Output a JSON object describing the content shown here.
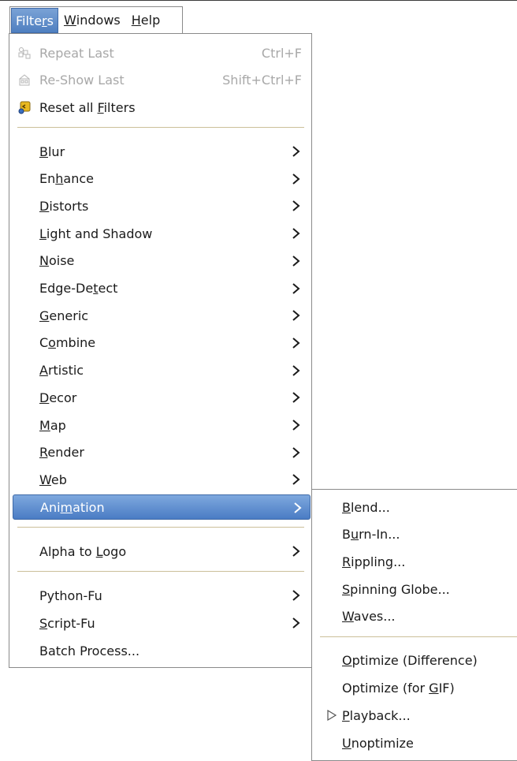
{
  "menubar": {
    "items": [
      {
        "pre": "Filte",
        "mn": "r",
        "post": "s",
        "active": true
      },
      {
        "pre": "",
        "mn": "W",
        "post": "indows"
      },
      {
        "pre": "",
        "mn": "H",
        "post": "elp"
      }
    ]
  },
  "filters_menu": {
    "repeat_last": {
      "label": "Repeat Last",
      "accel": "Ctrl+F",
      "icon": "repeat-icon"
    },
    "reshow_last": {
      "label": "Re-Show Last",
      "accel": "Shift+Ctrl+F",
      "icon": "reshow-icon"
    },
    "reset_all": {
      "pre": "Reset all ",
      "mn": "F",
      "post": "ilters",
      "icon": "reset-icon"
    },
    "submenus": [
      {
        "pre": "",
        "mn": "B",
        "post": "lur"
      },
      {
        "pre": "En",
        "mn": "h",
        "post": "ance"
      },
      {
        "pre": "",
        "mn": "D",
        "post": "istorts"
      },
      {
        "pre": "",
        "mn": "L",
        "post": "ight and Shadow"
      },
      {
        "pre": "",
        "mn": "N",
        "post": "oise"
      },
      {
        "pre": "Edge-De",
        "mn": "t",
        "post": "ect"
      },
      {
        "pre": "",
        "mn": "G",
        "post": "eneric"
      },
      {
        "pre": "C",
        "mn": "o",
        "post": "mbine"
      },
      {
        "pre": "",
        "mn": "A",
        "post": "rtistic"
      },
      {
        "pre": "",
        "mn": "D",
        "post": "ecor"
      },
      {
        "pre": "",
        "mn": "M",
        "post": "ap"
      },
      {
        "pre": "",
        "mn": "R",
        "post": "ender"
      },
      {
        "pre": "",
        "mn": "W",
        "post": "eb"
      },
      {
        "pre": "Ani",
        "mn": "m",
        "post": "ation"
      }
    ],
    "alpha_to_logo": {
      "pre": "Alpha to ",
      "mn": "L",
      "post": "ogo"
    },
    "python_fu": {
      "pre": "Python-Fu",
      "mn": "",
      "post": ""
    },
    "script_fu": {
      "pre": "",
      "mn": "S",
      "post": "cript-Fu"
    },
    "batch_process": {
      "label": "Batch Process..."
    }
  },
  "animation_submenu": {
    "items": [
      {
        "pre": "",
        "mn": "B",
        "post": "lend..."
      },
      {
        "pre": "B",
        "mn": "u",
        "post": "rn-In..."
      },
      {
        "pre": "",
        "mn": "R",
        "post": "ippling..."
      },
      {
        "pre": "",
        "mn": "S",
        "post": "pinning Globe..."
      },
      {
        "pre": "",
        "mn": "W",
        "post": "aves..."
      }
    ],
    "optimize_difference": {
      "pre": "",
      "mn": "O",
      "post": "ptimize (Difference)"
    },
    "optimize_gif": {
      "pre": "Optimize (for ",
      "mn": "G",
      "post": "IF)"
    },
    "playback": {
      "pre": "",
      "mn": "P",
      "post": "layback..."
    },
    "unoptimize": {
      "pre": "",
      "mn": "U",
      "post": "noptimize"
    }
  },
  "colors": {
    "highlight": "#4a7cc4",
    "separator": "#cbbf9a",
    "disabled_text": "#a8a8a8"
  }
}
